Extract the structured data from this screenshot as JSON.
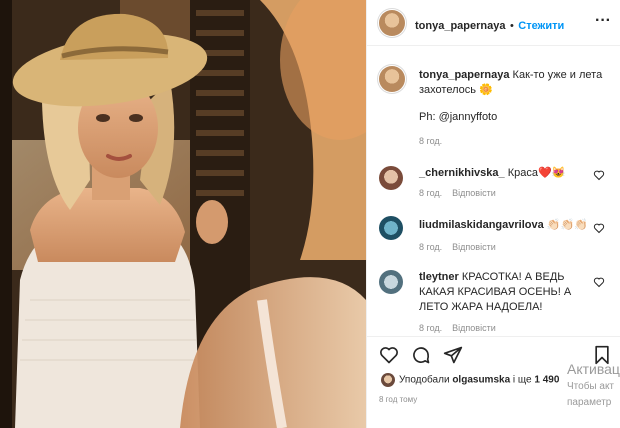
{
  "post": {
    "username": "tonya_papernaya",
    "separator": "•",
    "follow_label": "Стежити",
    "more_label": "···",
    "caption_text": "Как-то уже и лета захотелось 🌼",
    "caption_credit": "Ph: @jannyffoto",
    "caption_time": "8 год."
  },
  "comments": [
    {
      "username": "_chernikhivska_",
      "text": "Краса❤️😻",
      "time": "8 год.",
      "reply_label": "Відповісти"
    },
    {
      "username": "liudmilaskidangavrilova",
      "text": "👏🏻👏🏻👏🏻",
      "time": "8 год.",
      "reply_label": "Відповісти"
    },
    {
      "username": "tleytner",
      "text": "КРАСОТКА! А ВЕДЬ КАКАЯ КРАСИВАЯ ОСЕНЬ! А ЛЕТО ЖАРА НАДОЕЛА!",
      "time": "8 год.",
      "reply_label": "Відповісти"
    }
  ],
  "actions": {
    "liked_prefix": "Уподобали",
    "liked_user": "olgasumska",
    "liked_and": "і ще",
    "liked_count": "1 490",
    "posted_time": "8 год тому"
  },
  "watermark": {
    "line1": "Активац",
    "line2": "Чтобы акт",
    "line3": "параметр"
  },
  "colors": {
    "accent": "#0095f6",
    "text": "#262626",
    "muted": "#8e8e8e",
    "border": "#efefef"
  },
  "icons": [
    "heart-icon",
    "comment-icon",
    "share-icon",
    "bookmark-icon",
    "more-icon"
  ]
}
